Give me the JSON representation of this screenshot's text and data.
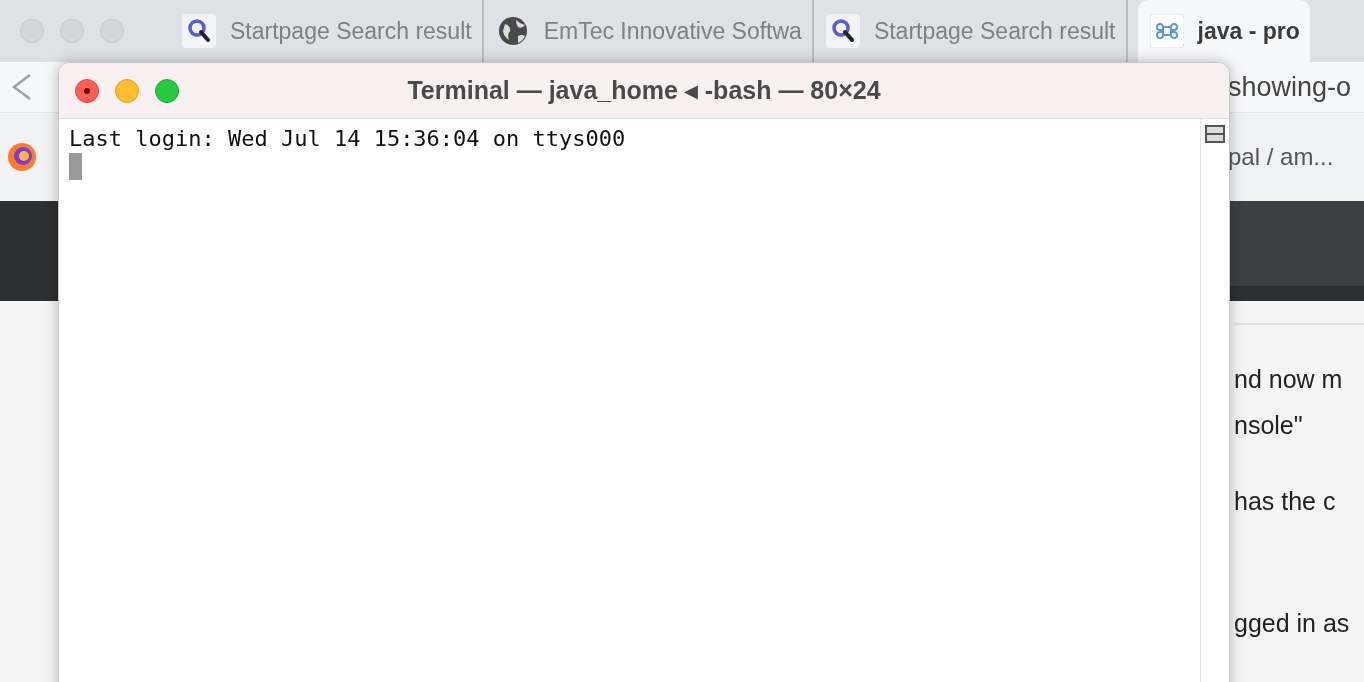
{
  "browser": {
    "tabs": [
      {
        "kind": "search",
        "label": "Startpage Search result",
        "selected": false
      },
      {
        "kind": "globe",
        "label": "EmTec Innovative Softwa",
        "selected": false
      },
      {
        "kind": "search",
        "label": "Startpage Search result",
        "selected": false
      },
      {
        "kind": "command",
        "label": "java - pro",
        "selected": true
      }
    ],
    "address": "showing-o",
    "bookmark": "pal / am...",
    "page_lines": [
      "nd now m",
      "nsole\"",
      "has the c",
      "gged in as"
    ]
  },
  "terminal": {
    "title": "Terminal — java_home ◂ -bash — 80×24",
    "lines": [
      "Last login: Wed Jul 14 15:36:04 on ttys000"
    ]
  }
}
